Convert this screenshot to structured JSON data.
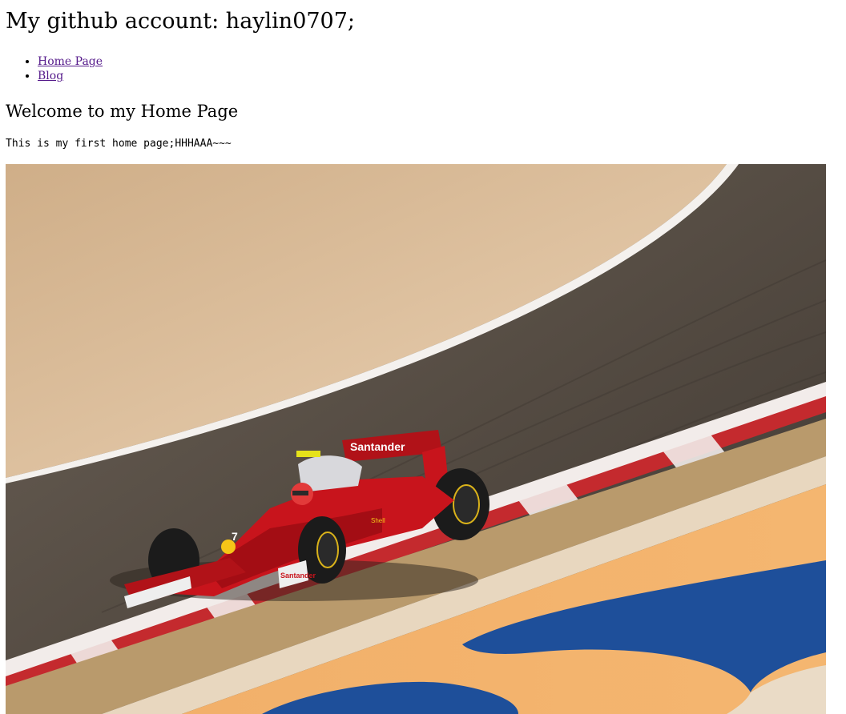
{
  "header": {
    "title": "My github account: haylin0707;"
  },
  "nav": {
    "items": [
      {
        "label": "Home Page"
      },
      {
        "label": "Blog"
      }
    ]
  },
  "main": {
    "heading": "Welcome to my Home Page",
    "intro": "This is my first home page;HHHAAA~~~"
  },
  "hero_image": {
    "subject": "red formula one race car on track",
    "car_livery": {
      "sponsor_wing": "Santander",
      "sponsor_side": "Santander",
      "number": "7",
      "sidepod": "Shell"
    },
    "colors": {
      "sand": "#dcbf9c",
      "asphalt": "#5a5147",
      "kerb_red": "#c42a2e",
      "runoff_orange": "#f0a85d",
      "runoff_blue": "#1e4f9a",
      "car_red": "#c8141c"
    }
  }
}
